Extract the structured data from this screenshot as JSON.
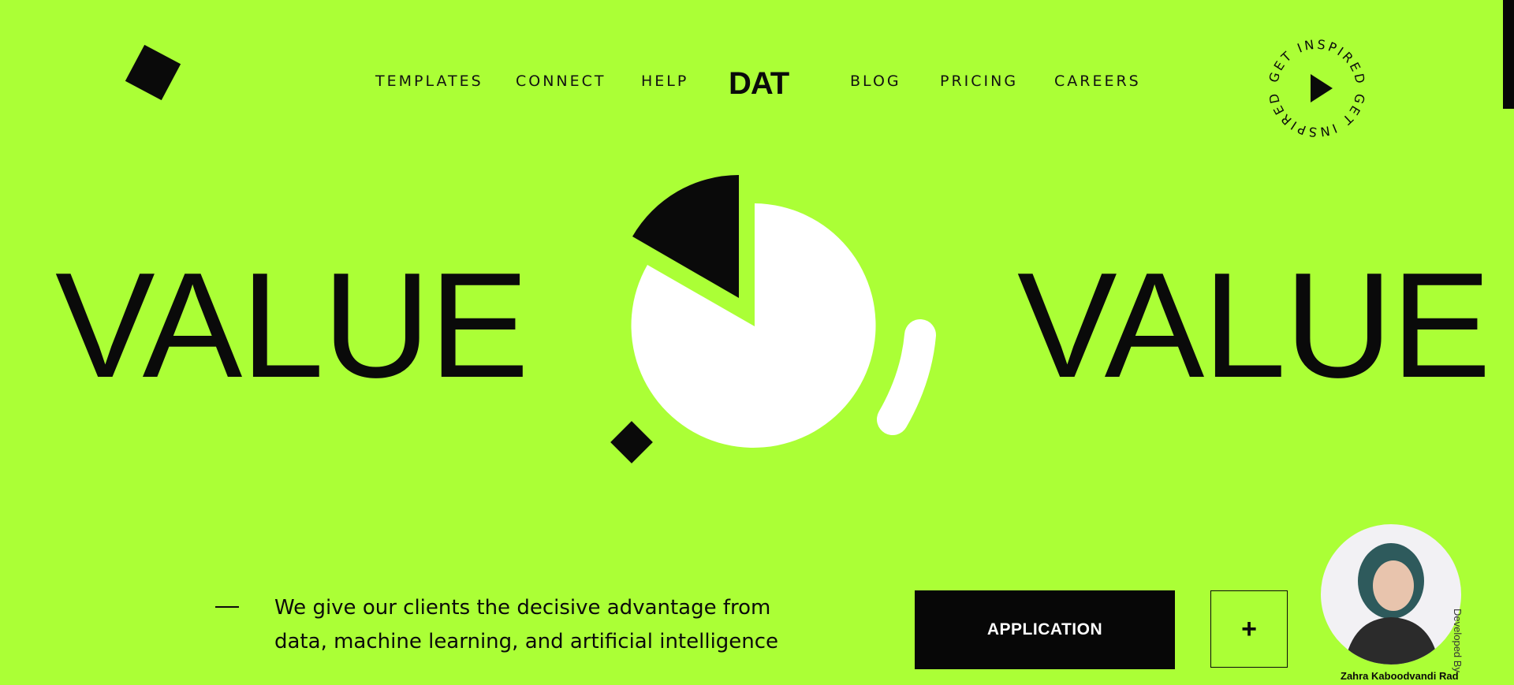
{
  "colors": {
    "background": "#abff36",
    "ink": "#0a0a0a",
    "white": "#ffffff"
  },
  "nav": {
    "items": [
      {
        "label": "TEMPLATES"
      },
      {
        "label": "CONNECT"
      },
      {
        "label": "HELP"
      },
      {
        "label": "BLOG"
      },
      {
        "label": "PRICING"
      },
      {
        "label": "CAREERS"
      }
    ],
    "logo": "DAT"
  },
  "badge": {
    "text": "GET INSPIRED GET INSPIRED",
    "icon": "play-icon"
  },
  "hero": {
    "word_left": "VALUE",
    "word_right": "VALUE",
    "icon": "pie-chart-graphic"
  },
  "tagline": {
    "line1": "We give our clients the decisive advantage from",
    "line2": "data, machine learning, and artificial intelligence"
  },
  "buttons": {
    "application": "APPLICATION",
    "plus": "+"
  },
  "developer": {
    "label": "Developed By",
    "name": "Zahra Kaboodvandi Rad"
  }
}
